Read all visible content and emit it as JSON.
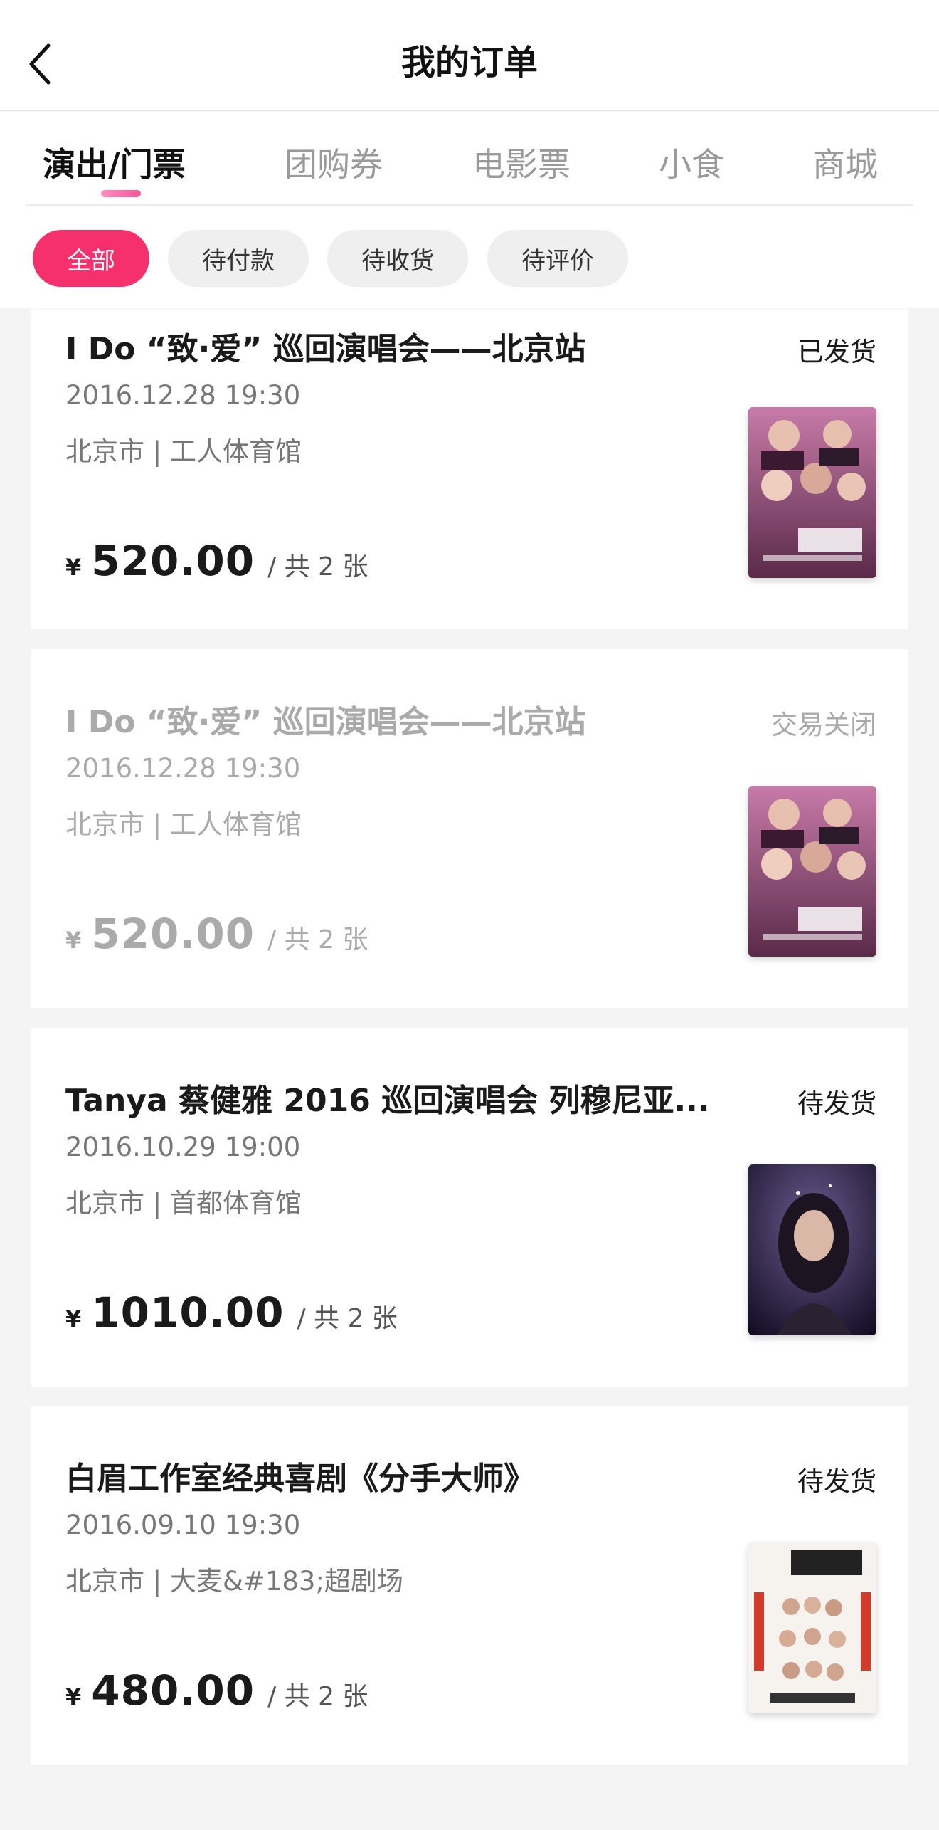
{
  "header": {
    "title": "我的订单",
    "back_icon": "chevron-left-icon"
  },
  "tabs": [
    {
      "label": "演出/门票",
      "active": true
    },
    {
      "label": "团购券",
      "active": false
    },
    {
      "label": "电影票",
      "active": false
    },
    {
      "label": "小食",
      "active": false
    },
    {
      "label": "商城",
      "active": false
    }
  ],
  "filters": [
    {
      "label": "全部",
      "active": true
    },
    {
      "label": "待付款",
      "active": false
    },
    {
      "label": "待收货",
      "active": false
    },
    {
      "label": "待评价",
      "active": false
    }
  ],
  "colors": {
    "accent": "#f5306c",
    "tab_indicator": "#f2569b",
    "muted_text": "#aaaaaa"
  },
  "orders": [
    {
      "title": "I Do “致·爱” 巡回演唱会——北京站",
      "status": "已发货",
      "datetime": "2016.12.28 19:30",
      "venue": "北京市 | 工人体育馆",
      "currency": "¥",
      "price": "520.00",
      "quantity": "/ 共 2 张",
      "poster": "concert-group-poster"
    },
    {
      "title": "I Do “致·爱” 巡回演唱会——北京站",
      "status": "交易关闭",
      "datetime": "2016.12.28 19:30",
      "venue": "北京市 | 工人体育馆",
      "currency": "¥",
      "price": "520.00",
      "quantity": "/ 共 2 张",
      "poster": "concert-group-poster"
    },
    {
      "title": "Tanya 蔡健雅 2016 巡回演唱会 列穆尼亚...",
      "status": "待发货",
      "datetime": "2016.10.29 19:00",
      "venue": "北京市 | 首都体育馆",
      "currency": "¥",
      "price": "1010.00",
      "quantity": "/ 共 2 张",
      "poster": "singer-portrait-poster"
    },
    {
      "title": "白眉工作室经典喜剧《分手大师》",
      "status": "待发货",
      "datetime": "2016.09.10 19:30",
      "venue": "北京市 | 大麦&#183;超剧场",
      "currency": "¥",
      "price": "480.00",
      "quantity": "/ 共 2 张",
      "poster": "comedy-play-poster"
    }
  ]
}
